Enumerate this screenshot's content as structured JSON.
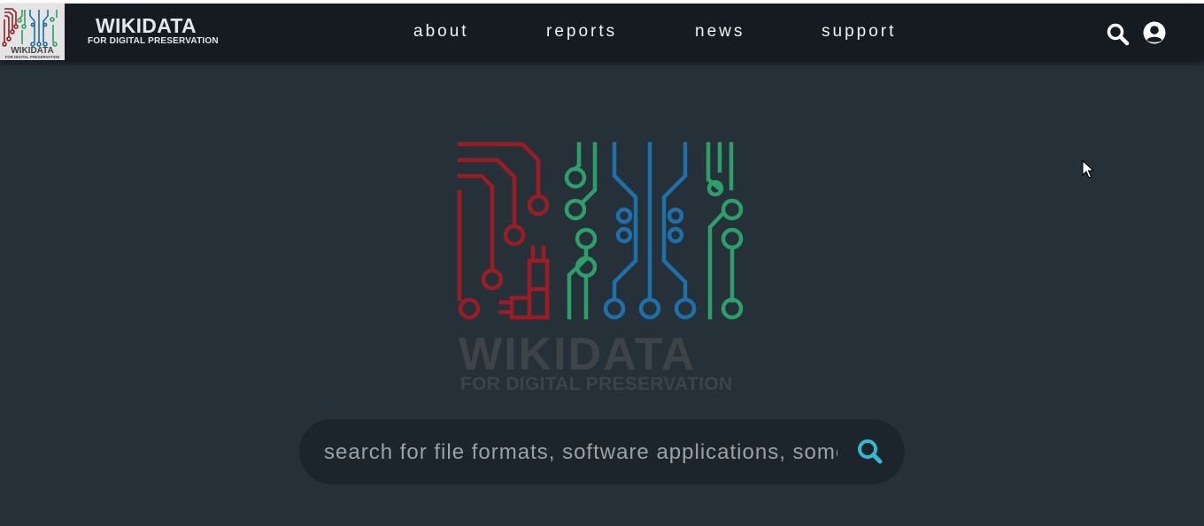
{
  "brand": {
    "title": "WIKIDATA",
    "subtitle": "FOR DIGITAL PRESERVATION",
    "logo_text_top": "WIKIDATA",
    "logo_text_bottom": "FOR DIGITAL PRESERVATION"
  },
  "nav": {
    "items": [
      {
        "label": "about"
      },
      {
        "label": "reports"
      },
      {
        "label": "news"
      },
      {
        "label": "support"
      }
    ],
    "icons": [
      "search-icon",
      "user-account-icon"
    ]
  },
  "hero": {
    "title": "WIKIDATA",
    "subtitle": "FOR DIGITAL PRESERVATION"
  },
  "search": {
    "placeholder": "search for file formats, software applications, some other things",
    "value": ""
  },
  "colors": {
    "navbar": "#151b20",
    "background": "#263039",
    "red": "#9b1c24",
    "green": "#2e9e6a",
    "blue": "#1f6fa8",
    "search_icon": "#35b9d0",
    "hero_text": "#3e4348"
  }
}
